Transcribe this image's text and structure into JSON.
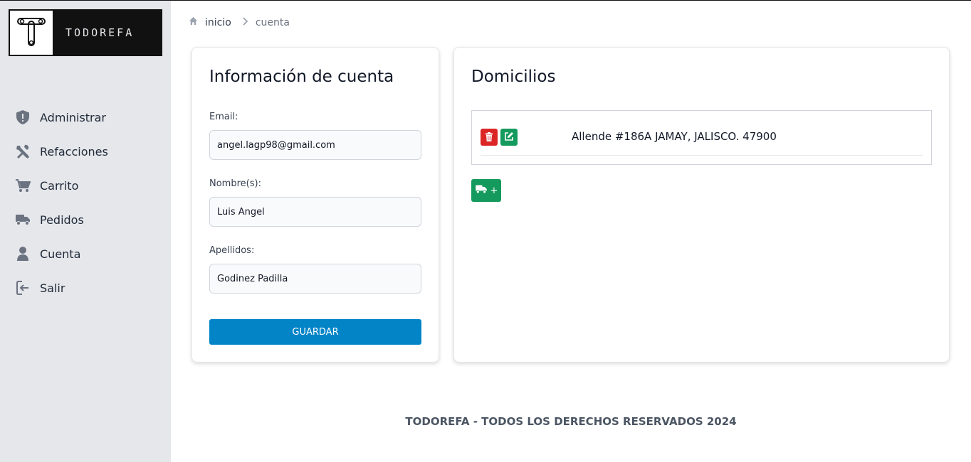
{
  "brand": {
    "name": "TODOREFA"
  },
  "sidebar": {
    "items": [
      {
        "label": "Administrar",
        "icon": "shield-icon"
      },
      {
        "label": "Refacciones",
        "icon": "tools-icon"
      },
      {
        "label": "Carrito",
        "icon": "cart-icon"
      },
      {
        "label": "Pedidos",
        "icon": "truck-icon"
      },
      {
        "label": "Cuenta",
        "icon": "user-icon"
      },
      {
        "label": "Salir",
        "icon": "logout-icon"
      }
    ]
  },
  "breadcrumb": {
    "home": "inicio",
    "current": "cuenta"
  },
  "account": {
    "title": "Información de cuenta",
    "email_label": "Email:",
    "email_value": "angel.lagp98@gmail.com",
    "name_label": "Nombre(s):",
    "name_value": "Luis Angel",
    "lastname_label": "Apellidos:",
    "lastname_value": "Godinez Padilla",
    "save_label": "GUARDAR"
  },
  "addresses": {
    "title": "Domicilios",
    "items": [
      {
        "text": "Allende #186A JAMAY, JALISCO. 47900"
      }
    ],
    "add_label": "+"
  },
  "footer": {
    "text": "TODOREFA - TODOS LOS DERECHOS RESERVADOS 2024"
  },
  "colors": {
    "primary": "#0284c7",
    "danger": "#dc2626",
    "success": "#159a5d",
    "sidebar_bg": "#e5e7eb"
  }
}
